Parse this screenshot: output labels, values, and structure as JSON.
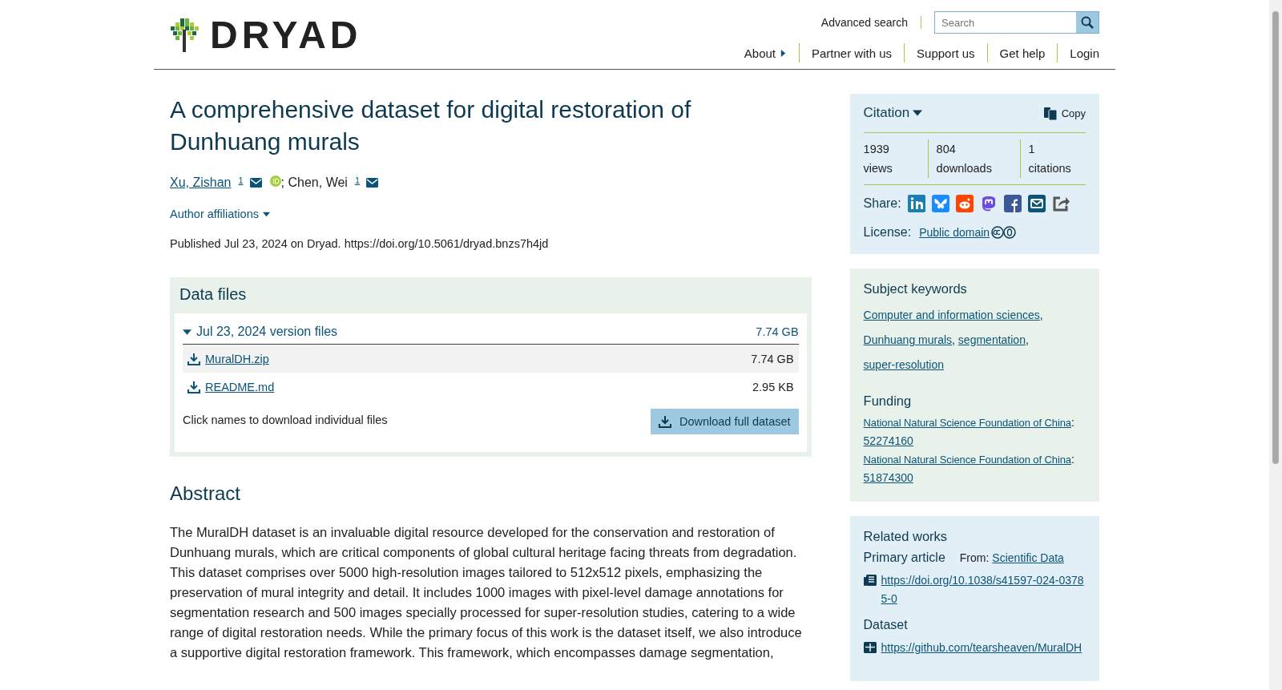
{
  "header": {
    "logo": "DRYAD",
    "advanced_search": "Advanced search",
    "search": {
      "placeholder": "Search"
    },
    "nav": [
      {
        "label": "About",
        "kind": "menu"
      },
      {
        "label": "Partner with us",
        "kind": "link"
      },
      {
        "label": "Support us",
        "kind": "link"
      },
      {
        "label": "Get help",
        "kind": "link"
      },
      {
        "label": "Login",
        "kind": "link"
      }
    ]
  },
  "title": "A comprehensive dataset for digital restoration of Dunhuang murals",
  "authors": [
    {
      "name": "Xu, Zishan",
      "linked": true,
      "affiliation": "1",
      "orcid": true
    },
    {
      "name": "Chen, Wei",
      "linked": false,
      "affiliation": "1",
      "orcid": false,
      "separator": "; "
    }
  ],
  "affiliations_toggle": "Author affiliations",
  "published": "Published Jul 23, 2024 on Dryad. https://doi.org/10.5061/dryad.bnzs7h4jd",
  "data_files": {
    "heading": "Data files",
    "version": {
      "label": "Jul 23, 2024 version files",
      "size": "7.74 GB",
      "expanded": true
    },
    "files": [
      {
        "name": "MuralDH.zip",
        "size": "7.74 GB"
      },
      {
        "name": "README.md",
        "size": "2.95 KB"
      }
    ],
    "hint": "Click names to download individual files",
    "download_button": "Download full dataset"
  },
  "abstract": {
    "heading": "Abstract",
    "text": "The MuralDH dataset is an invaluable digital resource developed for the conservation and restoration of Dunhuang murals, which are critical components of global cultural heritage facing threats from degradation. This dataset comprises over 5000 high-resolution images tailored to 512x512 pixels, emphasizing the preservation of mural integrity and detail. It includes 1000 images with pixel-level damage annotations for segmentation research and 500 images specially processed for super-resolution studies, catering to a wide range of digital restoration needs. While the primary focus of this work is the dataset itself, we also introduce a supportive digital restoration framework. This framework, which encompasses damage segmentation,"
  },
  "citation": {
    "toggle": "Citation",
    "copy": "Copy",
    "metrics": [
      {
        "value": "1939",
        "label": "views"
      },
      {
        "value": "804",
        "label": "downloads"
      },
      {
        "value": "1",
        "label": "citations"
      }
    ],
    "share_label": "Share:",
    "share": [
      {
        "kind": "linkedin",
        "color": "#1a7fb5"
      },
      {
        "kind": "bluesky",
        "color": "#1a8cff"
      },
      {
        "kind": "reddit",
        "color": "#ff4500"
      },
      {
        "kind": "mastodon",
        "color": "#6a4de0"
      },
      {
        "kind": "facebook",
        "color": "#3b5998"
      },
      {
        "kind": "email",
        "color": "#0b5479"
      },
      {
        "kind": "share",
        "color": "#555555"
      }
    ],
    "license_label": "License:",
    "license": "Public domain"
  },
  "keywords": {
    "heading": "Subject keywords",
    "items": [
      {
        "label": "Computer and information sciences",
        "separator": ","
      },
      {
        "label": "Dunhuang murals",
        "separator": ","
      },
      {
        "label": "segmentation",
        "separator": ","
      },
      {
        "label": "super-resolution"
      }
    ]
  },
  "funding": {
    "heading": "Funding",
    "items": [
      {
        "funder": "National Natural Science Foundation of China",
        "separator": ":",
        "award": "52274160"
      },
      {
        "funder": "National Natural Science Foundation of China",
        "separator": ":",
        "award": "51874300"
      }
    ]
  },
  "related": {
    "heading": "Related works",
    "groups": [
      {
        "kind": "article",
        "label": "Primary article",
        "from_label": "From:",
        "from": "Scientific Data",
        "url": "https://doi.org/10.1038/s41597-024-03785-0"
      },
      {
        "kind": "dataset",
        "label": "Dataset",
        "url": "https://github.com/tearsheaven/MuralDH"
      }
    ]
  }
}
